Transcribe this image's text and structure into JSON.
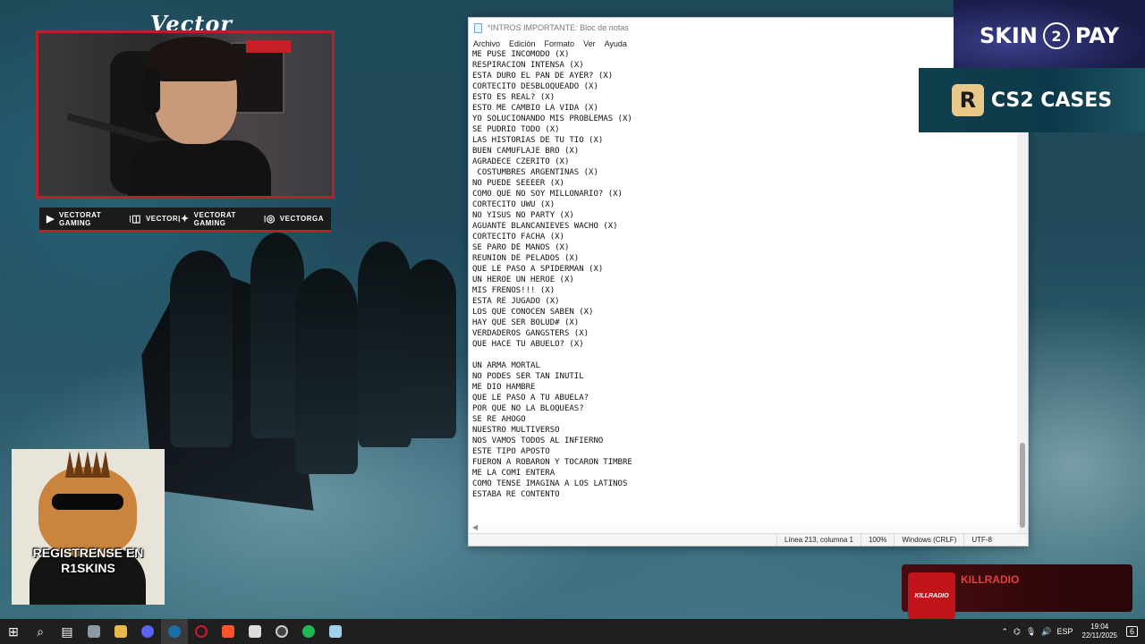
{
  "webcam": {
    "title": "Vector"
  },
  "socials": [
    {
      "icon": "youtube-icon",
      "label": "VECTORAT GAMING"
    },
    {
      "icon": "twitch-icon",
      "label": "VECTOR"
    },
    {
      "icon": "twitter-icon",
      "label": "VECTORAT GAMING"
    },
    {
      "icon": "instagram-icon",
      "label": "VECTORGA"
    }
  ],
  "notepad": {
    "title": "*INTROS IMPORTANTE: Bloc de notas",
    "menu": [
      "Archivo",
      "Edición",
      "Formato",
      "Ver",
      "Ayuda"
    ],
    "lines": [
      "ME PUSE INCOMODO (X)",
      "RESPIRACION INTENSA (X)",
      "ESTA DURO EL PAN DE AYER? (X)",
      "CORTECITO DESBLOQUEADO (X)",
      "ESTO ES REAL? (X)",
      "ESTO ME CAMBIO LA VIDA (X)",
      "YO SOLUCIONANDO MIS PROBLEMAS (X)",
      "SE PUDRIO TODO (X)",
      "LAS HISTORIAS DE TU TIO (X)",
      "BUEN CAMUFLAJE BRO (X)",
      "AGRADECE CZERITO (X)",
      " COSTUMBRES ARGENTINAS (X)",
      "NO PUEDE SEEEER (X)",
      "COMO QUE NO SOY MILLONARIO? (X)",
      "CORTECITO UWU (X)",
      "NO YISUS NO PARTY (X)",
      "AGUANTE BLANCANIEVES WACHO (X)",
      "CORTECITO FACHA (X)",
      "SE PARO DE MANOS (X)",
      "REUNION DE PELADOS (X)",
      "QUE LE PASO A SPIDERMAN (X)",
      "UN HEROE UN HEROE (X)",
      "MIS FRENOS!!! (X)",
      "ESTA RE JUGADO (X)",
      "LOS QUE CONOCEN SABEN (X)",
      "HAY QUE SER BOLUD# (X)",
      "VERDADEROS GANGSTERS (X)",
      "QUE HACE TU ABUELO? (X)",
      "",
      "UN ARMA MORTAL",
      "NO PODES SER TAN INUTIL",
      "ME DIO HAMBRE",
      "QUE LE PASO A TU ABUELA?",
      "POR QUE NO LA BLOQUEAS?",
      "SE RE AHOGO",
      "NUESTRO MULTIVERSO",
      "NOS VAMOS TODOS AL INFIERNO",
      "ESTE TIPO APOSTO",
      "FUERON A ROBARON Y TOCARON TIMBRE",
      "ME LA COMI ENTERA",
      "COMO TENSE IMAGINA A LOS LATINOS",
      "ESTABA RE CONTENTO"
    ],
    "status": {
      "position": "Línea 213, columna 1",
      "zoom": "100%",
      "line_ending": "Windows (CRLF)",
      "encoding": "UTF-8"
    }
  },
  "ads": {
    "skin2pay": {
      "left": "SKIN",
      "mid": "2",
      "right": "PAY"
    },
    "cs2cases": {
      "logo": "R",
      "label": "CS2 CASES"
    }
  },
  "promo": {
    "line1": "REGISTRENSE EN",
    "line2": "R1SKINS"
  },
  "killradio": {
    "logo": "KILLRADIO",
    "label": "KILLRADIO"
  },
  "taskbar": {
    "apps": [
      "start-icon",
      "search-icon",
      "task-view-icon",
      "file-manager-icon",
      "folder-icon",
      "discord-icon",
      "steam-icon",
      "opera-icon",
      "brave-icon",
      "epic-icon",
      "obs-icon",
      "spotify-icon",
      "notepad-icon"
    ],
    "active_index": 6,
    "language": "ESP",
    "time": "19:04",
    "date": "22/11/2025",
    "notifications": "6"
  }
}
